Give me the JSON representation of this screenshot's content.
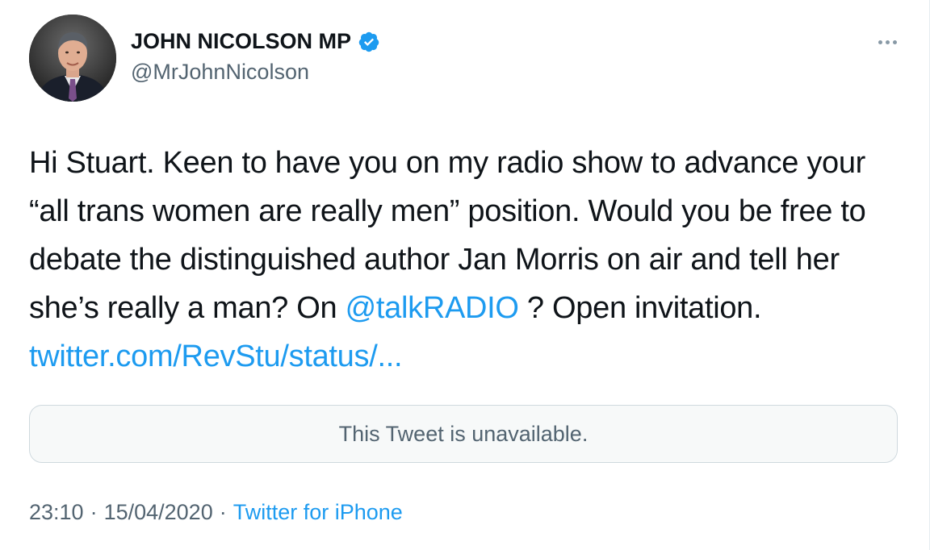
{
  "author": {
    "display_name": "JOHN NICOLSON MP",
    "handle": "@MrJohnNicolson",
    "verified_icon": "verified-badge-icon",
    "avatar_icon": "profile-photo"
  },
  "menu": {
    "icon": "more-options-icon"
  },
  "tweet": {
    "text_part1": "Hi Stuart. Keen to have you on my radio show to advance your “all trans women are really men” position. Would you be free to debate the distinguished author Jan Morris on air and tell her she’s really a man? On ",
    "mention": "@talkRADIO",
    "text_part2": " ? Open invitation.",
    "link": "twitter.com/RevStu/status/..."
  },
  "quoted_tweet": {
    "message": "This Tweet is unavailable."
  },
  "meta": {
    "time": "23:10",
    "separator1": "·",
    "date": "15/04/2020",
    "separator2": "·",
    "source": "Twitter for iPhone"
  },
  "colors": {
    "link_blue": "#1d9bf0",
    "secondary_text": "#536471",
    "primary_text": "#0f1419",
    "verified_blue": "#1d9bf0"
  }
}
